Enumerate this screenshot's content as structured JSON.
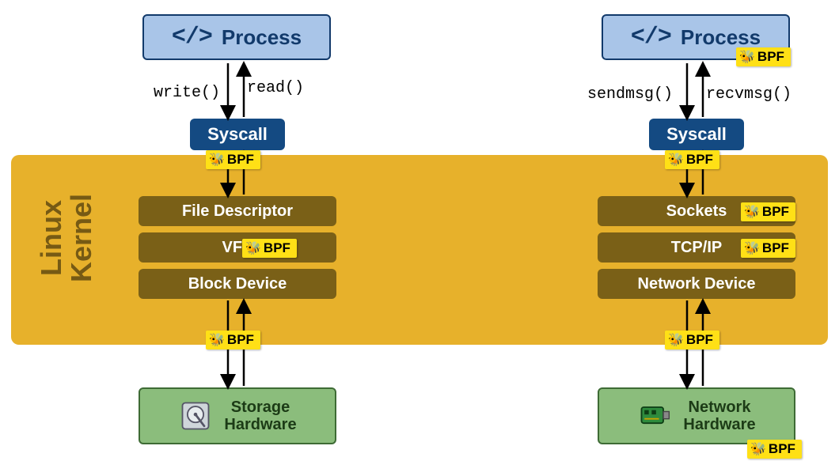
{
  "kernel_label": "Linux\nKernel",
  "left": {
    "process": "Process",
    "write": "write()",
    "read": "read()",
    "syscall": "Syscall",
    "fd": "File Descriptor",
    "vfs": "VFS",
    "block": "Block Device",
    "hw_line1": "Storage",
    "hw_line2": "Hardware"
  },
  "right": {
    "process": "Process",
    "send": "sendmsg()",
    "recv": "recvmsg()",
    "syscall": "Syscall",
    "sockets": "Sockets",
    "tcpip": "TCP/IP",
    "netdev": "Network Device",
    "hw_line1": "Network",
    "hw_line2": "Hardware"
  },
  "bpf_label": "BPF"
}
